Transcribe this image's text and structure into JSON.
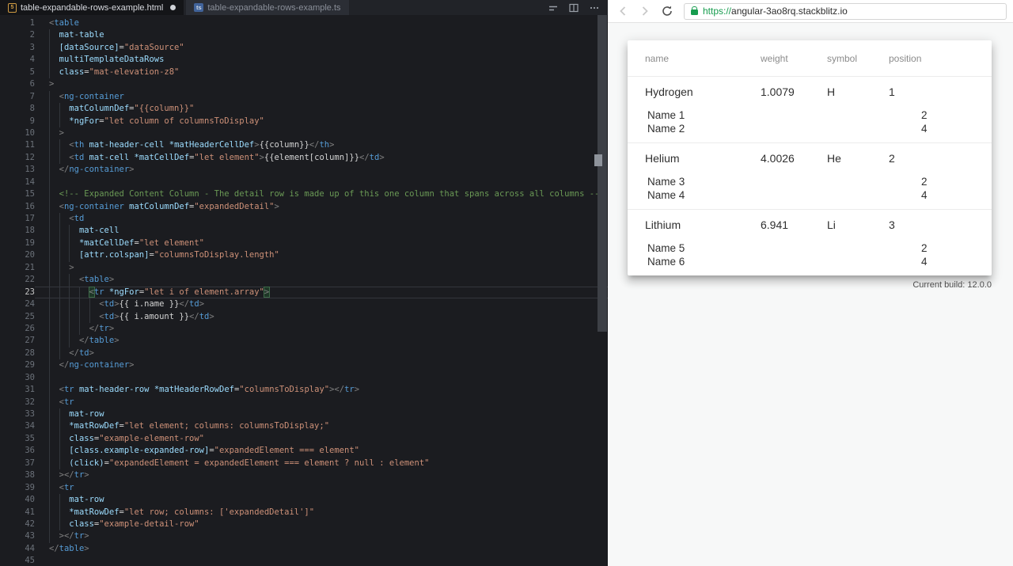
{
  "theme": {
    "editor_bg": "#1b1c20",
    "tabbar_bg": "#212328",
    "tab_active_bg": "#141518",
    "tab_inactive_bg": "#2b2e35",
    "tag": "#569cd6",
    "attr": "#9cdcfe",
    "str": "#ce9178",
    "punct": "#808080",
    "text": "#d4d4d4",
    "comment": "#6a9955",
    "lineno": "#6b7179",
    "lineno_active": "#c6c6c6",
    "guide": "#33363c",
    "url_green": "#169c4e",
    "html_icon": "#cf9b43",
    "ts_icon": "#41639a"
  },
  "editor": {
    "tabs": [
      {
        "label": "table-expandable-rows-example.html",
        "icon": "html5-icon",
        "glyph": "5",
        "modified": true,
        "active": true
      },
      {
        "label": "table-expandable-rows-example.ts",
        "icon": "typescript-icon",
        "glyph": "ts",
        "modified": false,
        "active": false
      }
    ],
    "actions": [
      "open-changes-icon",
      "split-editor-icon",
      "more-actions-icon"
    ],
    "lines": [
      {
        "g": 0,
        "s": [
          [
            "p",
            "<"
          ],
          [
            "t",
            "table"
          ]
        ]
      },
      {
        "g": 1,
        "s": [
          [
            "x",
            "  "
          ],
          [
            "a",
            "mat-table"
          ]
        ]
      },
      {
        "g": 1,
        "s": [
          [
            "x",
            "  "
          ],
          [
            "a",
            "[dataSource]"
          ],
          [
            "x",
            "="
          ],
          [
            "s",
            "\"dataSource\""
          ]
        ]
      },
      {
        "g": 1,
        "s": [
          [
            "x",
            "  "
          ],
          [
            "a",
            "multiTemplateDataRows"
          ]
        ]
      },
      {
        "g": 1,
        "s": [
          [
            "x",
            "  "
          ],
          [
            "a",
            "class"
          ],
          [
            "x",
            "="
          ],
          [
            "s",
            "\"mat-elevation-z8\""
          ]
        ]
      },
      {
        "g": 0,
        "s": [
          [
            "p",
            ">"
          ]
        ]
      },
      {
        "g": 1,
        "s": [
          [
            "x",
            "  "
          ],
          [
            "p",
            "<"
          ],
          [
            "t",
            "ng-container"
          ]
        ]
      },
      {
        "g": 2,
        "s": [
          [
            "x",
            "    "
          ],
          [
            "a",
            "matColumnDef"
          ],
          [
            "x",
            "="
          ],
          [
            "s",
            "\"{{column}}\""
          ]
        ]
      },
      {
        "g": 2,
        "s": [
          [
            "x",
            "    "
          ],
          [
            "a",
            "*ngFor"
          ],
          [
            "x",
            "="
          ],
          [
            "s",
            "\"let column of columnsToDisplay\""
          ]
        ]
      },
      {
        "g": 1,
        "s": [
          [
            "x",
            "  "
          ],
          [
            "p",
            ">"
          ]
        ]
      },
      {
        "g": 2,
        "s": [
          [
            "x",
            "    "
          ],
          [
            "p",
            "<"
          ],
          [
            "t",
            "th"
          ],
          [
            "x",
            " "
          ],
          [
            "a",
            "mat-header-cell"
          ],
          [
            "x",
            " "
          ],
          [
            "a",
            "*matHeaderCellDef"
          ],
          [
            "p",
            ">"
          ],
          [
            "x",
            "{{column}}"
          ],
          [
            "p",
            "</"
          ],
          [
            "t",
            "th"
          ],
          [
            "p",
            ">"
          ]
        ]
      },
      {
        "g": 2,
        "s": [
          [
            "x",
            "    "
          ],
          [
            "p",
            "<"
          ],
          [
            "t",
            "td"
          ],
          [
            "x",
            " "
          ],
          [
            "a",
            "mat-cell"
          ],
          [
            "x",
            " "
          ],
          [
            "a",
            "*matCellDef"
          ],
          [
            "x",
            "="
          ],
          [
            "s",
            "\"let element\""
          ],
          [
            "p",
            ">"
          ],
          [
            "x",
            "{{element[column]}}"
          ],
          [
            "p",
            "</"
          ],
          [
            "t",
            "td"
          ],
          [
            "p",
            ">"
          ]
        ]
      },
      {
        "g": 1,
        "s": [
          [
            "x",
            "  "
          ],
          [
            "p",
            "</"
          ],
          [
            "t",
            "ng-container"
          ],
          [
            "p",
            ">"
          ]
        ]
      },
      {
        "g": 1,
        "s": []
      },
      {
        "g": 1,
        "s": [
          [
            "x",
            "  "
          ],
          [
            "c",
            "<!-- Expanded Content Column - The detail row is made up of this one column that spans across all columns -->"
          ]
        ]
      },
      {
        "g": 1,
        "s": [
          [
            "x",
            "  "
          ],
          [
            "p",
            "<"
          ],
          [
            "t",
            "ng-container"
          ],
          [
            "x",
            " "
          ],
          [
            "a",
            "matColumnDef"
          ],
          [
            "x",
            "="
          ],
          [
            "s",
            "\"expandedDetail\""
          ],
          [
            "p",
            ">"
          ]
        ]
      },
      {
        "g": 2,
        "s": [
          [
            "x",
            "    "
          ],
          [
            "p",
            "<"
          ],
          [
            "t",
            "td"
          ]
        ]
      },
      {
        "g": 3,
        "s": [
          [
            "x",
            "      "
          ],
          [
            "a",
            "mat-cell"
          ]
        ]
      },
      {
        "g": 3,
        "s": [
          [
            "x",
            "      "
          ],
          [
            "a",
            "*matCellDef"
          ],
          [
            "x",
            "="
          ],
          [
            "s",
            "\"let element\""
          ]
        ]
      },
      {
        "g": 3,
        "s": [
          [
            "x",
            "      "
          ],
          [
            "a",
            "[attr.colspan]"
          ],
          [
            "x",
            "="
          ],
          [
            "s",
            "\"columnsToDisplay.length\""
          ]
        ]
      },
      {
        "g": 2,
        "s": [
          [
            "x",
            "    "
          ],
          [
            "p",
            ">"
          ]
        ]
      },
      {
        "g": 3,
        "s": [
          [
            "x",
            "      "
          ],
          [
            "p",
            "<"
          ],
          [
            "t",
            "table"
          ],
          [
            "p",
            ">"
          ]
        ]
      },
      {
        "g": 4,
        "cur": true,
        "s": [
          [
            "x",
            "        "
          ],
          [
            "pb",
            "<"
          ],
          [
            "t",
            "tr"
          ],
          [
            "x",
            " "
          ],
          [
            "a",
            "*ngFor"
          ],
          [
            "x",
            "="
          ],
          [
            "s",
            "\"let i of element.array\""
          ],
          [
            "k",
            ""
          ],
          [
            "pb",
            ">"
          ]
        ]
      },
      {
        "g": 5,
        "s": [
          [
            "x",
            "          "
          ],
          [
            "p",
            "<"
          ],
          [
            "t",
            "td"
          ],
          [
            "p",
            ">"
          ],
          [
            "x",
            "{{ i.name }}"
          ],
          [
            "p",
            "</"
          ],
          [
            "t",
            "td"
          ],
          [
            "p",
            ">"
          ]
        ]
      },
      {
        "g": 5,
        "s": [
          [
            "x",
            "          "
          ],
          [
            "p",
            "<"
          ],
          [
            "t",
            "td"
          ],
          [
            "p",
            ">"
          ],
          [
            "x",
            "{{ i.amount }}"
          ],
          [
            "p",
            "</"
          ],
          [
            "t",
            "td"
          ],
          [
            "p",
            ">"
          ]
        ]
      },
      {
        "g": 4,
        "s": [
          [
            "x",
            "        "
          ],
          [
            "p",
            "</"
          ],
          [
            "t",
            "tr"
          ],
          [
            "p",
            ">"
          ]
        ]
      },
      {
        "g": 3,
        "s": [
          [
            "x",
            "      "
          ],
          [
            "p",
            "</"
          ],
          [
            "t",
            "table"
          ],
          [
            "p",
            ">"
          ]
        ]
      },
      {
        "g": 2,
        "s": [
          [
            "x",
            "    "
          ],
          [
            "p",
            "</"
          ],
          [
            "t",
            "td"
          ],
          [
            "p",
            ">"
          ]
        ]
      },
      {
        "g": 1,
        "s": [
          [
            "x",
            "  "
          ],
          [
            "p",
            "</"
          ],
          [
            "t",
            "ng-container"
          ],
          [
            "p",
            ">"
          ]
        ]
      },
      {
        "g": 1,
        "s": []
      },
      {
        "g": 1,
        "s": [
          [
            "x",
            "  "
          ],
          [
            "p",
            "<"
          ],
          [
            "t",
            "tr"
          ],
          [
            "x",
            " "
          ],
          [
            "a",
            "mat-header-row"
          ],
          [
            "x",
            " "
          ],
          [
            "a",
            "*matHeaderRowDef"
          ],
          [
            "x",
            "="
          ],
          [
            "s",
            "\"columnsToDisplay\""
          ],
          [
            "p",
            ">"
          ],
          [
            "p",
            "</"
          ],
          [
            "t",
            "tr"
          ],
          [
            "p",
            ">"
          ]
        ]
      },
      {
        "g": 1,
        "s": [
          [
            "x",
            "  "
          ],
          [
            "p",
            "<"
          ],
          [
            "t",
            "tr"
          ]
        ]
      },
      {
        "g": 2,
        "s": [
          [
            "x",
            "    "
          ],
          [
            "a",
            "mat-row"
          ]
        ]
      },
      {
        "g": 2,
        "s": [
          [
            "x",
            "    "
          ],
          [
            "a",
            "*matRowDef"
          ],
          [
            "x",
            "="
          ],
          [
            "s",
            "\"let element; columns: columnsToDisplay;\""
          ]
        ]
      },
      {
        "g": 2,
        "s": [
          [
            "x",
            "    "
          ],
          [
            "a",
            "class"
          ],
          [
            "x",
            "="
          ],
          [
            "s",
            "\"example-element-row\""
          ]
        ]
      },
      {
        "g": 2,
        "s": [
          [
            "x",
            "    "
          ],
          [
            "a",
            "[class.example-expanded-row]"
          ],
          [
            "x",
            "="
          ],
          [
            "s",
            "\"expandedElement === element\""
          ]
        ]
      },
      {
        "g": 2,
        "s": [
          [
            "x",
            "    "
          ],
          [
            "a",
            "(click)"
          ],
          [
            "x",
            "="
          ],
          [
            "s",
            "\"expandedElement = expandedElement === element ? null : element\""
          ]
        ]
      },
      {
        "g": 1,
        "s": [
          [
            "x",
            "  "
          ],
          [
            "p",
            ">"
          ],
          [
            "p",
            "</"
          ],
          [
            "t",
            "tr"
          ],
          [
            "p",
            ">"
          ]
        ]
      },
      {
        "g": 1,
        "s": [
          [
            "x",
            "  "
          ],
          [
            "p",
            "<"
          ],
          [
            "t",
            "tr"
          ]
        ]
      },
      {
        "g": 2,
        "s": [
          [
            "x",
            "    "
          ],
          [
            "a",
            "mat-row"
          ]
        ]
      },
      {
        "g": 2,
        "s": [
          [
            "x",
            "    "
          ],
          [
            "a",
            "*matRowDef"
          ],
          [
            "x",
            "="
          ],
          [
            "s",
            "\"let row; columns: ['expandedDetail']\""
          ]
        ]
      },
      {
        "g": 2,
        "s": [
          [
            "x",
            "    "
          ],
          [
            "a",
            "class"
          ],
          [
            "x",
            "="
          ],
          [
            "s",
            "\"example-detail-row\""
          ]
        ]
      },
      {
        "g": 1,
        "s": [
          [
            "x",
            "  "
          ],
          [
            "p",
            ">"
          ],
          [
            "p",
            "</"
          ],
          [
            "t",
            "tr"
          ],
          [
            "p",
            ">"
          ]
        ]
      },
      {
        "g": 0,
        "s": [
          [
            "p",
            "</"
          ],
          [
            "t",
            "table"
          ],
          [
            "p",
            ">"
          ]
        ]
      },
      {
        "g": 0,
        "s": []
      }
    ]
  },
  "preview": {
    "url": {
      "protocol": "https://",
      "host": "angular-3ao8rq.stackblitz.io"
    },
    "table": {
      "columns": [
        "name",
        "weight",
        "symbol",
        "position"
      ],
      "rows": [
        {
          "name": "Hydrogen",
          "weight": "1.0079",
          "symbol": "H",
          "position": "1",
          "details": [
            [
              "Name 1",
              "2"
            ],
            [
              "Name 2",
              "4"
            ]
          ]
        },
        {
          "name": "Helium",
          "weight": "4.0026",
          "symbol": "He",
          "position": "2",
          "details": [
            [
              "Name 3",
              "2"
            ],
            [
              "Name 4",
              "4"
            ]
          ]
        },
        {
          "name": "Lithium",
          "weight": "6.941",
          "symbol": "Li",
          "position": "3",
          "details": [
            [
              "Name 5",
              "2"
            ],
            [
              "Name 6",
              "4"
            ]
          ]
        }
      ]
    },
    "build_info": "Current build: 12.0.0"
  }
}
